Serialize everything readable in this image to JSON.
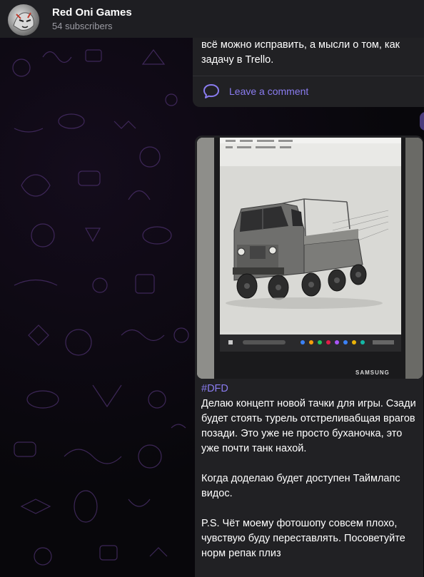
{
  "header": {
    "title": "Red Oni Games",
    "subscribers": "54 subscribers"
  },
  "messages": {
    "previous": {
      "lines": [
        "всё можно исправить, а мысли о том, как",
        "задачу в Trello."
      ],
      "comment_label": "Leave a comment"
    },
    "post": {
      "hashtag": "#DFD",
      "paragraphs": [
        "Делаю концепт новой тачки для игры. Сзади будет стоять турель отстреливабщая врагов позади. Это уже не просто буханочка, это уже почти танк нахой.",
        "Когда доделаю будет доступен Таймлапс видос.",
        "P.S. Чёт моему фотошопу совсем плохо, чувствую буду переставлять. Посоветуйте норм репак плиз"
      ],
      "photo": {
        "monitor_brand": "SAMSUNG"
      }
    }
  },
  "colors": {
    "accent": "#8a7cf0",
    "bubble": "#212124",
    "header": "#1e1e22"
  }
}
